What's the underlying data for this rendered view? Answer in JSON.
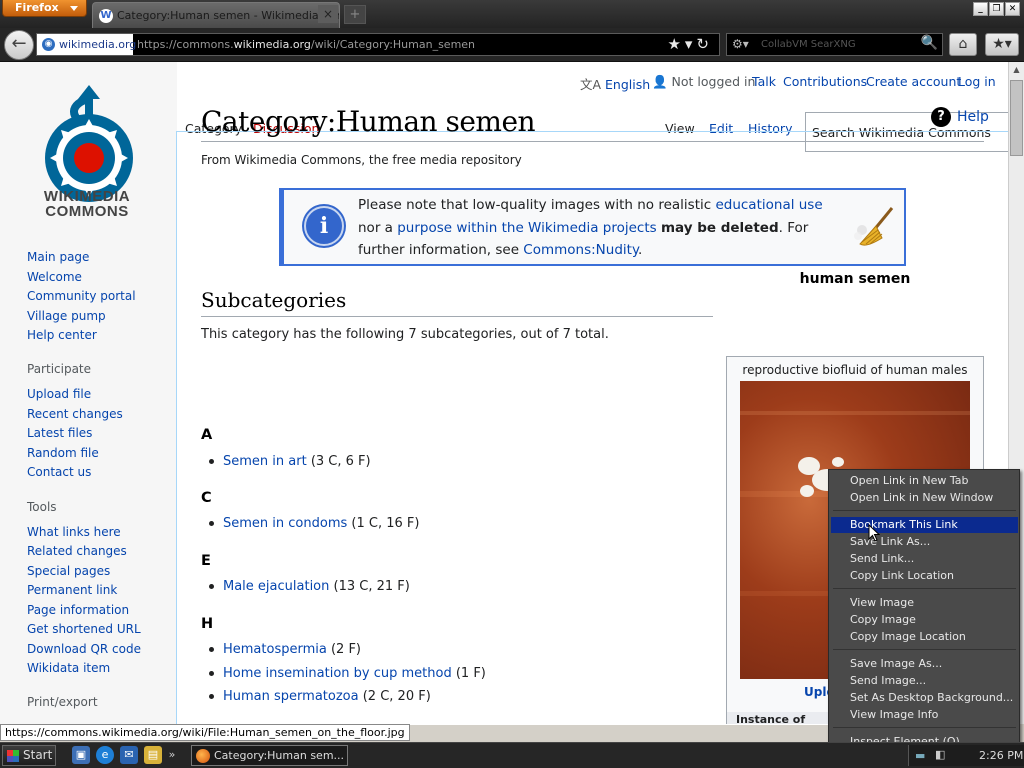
{
  "browser": {
    "menu_button": "Firefox",
    "tab_title": "Category:Human semen - Wikimedia Commons",
    "identity": "wikimedia.org",
    "url_prefix": "https://commons.",
    "url_domain": "wikimedia.org",
    "url_path": "/wiki/Category:Human_semen",
    "search_placeholder": "CollabVM SearXNG"
  },
  "personal": {
    "language": "English",
    "not_logged_in": "Not logged in",
    "talk": "Talk",
    "contributions": "Contributions",
    "create_account": "Create account",
    "login": "Log in"
  },
  "tabs": {
    "category": "Category",
    "discussion": "Discussion",
    "view": "View",
    "edit": "Edit",
    "history": "History",
    "search_placeholder": "Search Wikimedia Commons"
  },
  "logo": {
    "line1": "WIKIMEDIA",
    "line2": "COMMONS"
  },
  "sidebar": {
    "main": [
      "Main page",
      "Welcome",
      "Community portal",
      "Village pump",
      "Help center"
    ],
    "participate_heading": "Participate",
    "participate": [
      "Upload file",
      "Recent changes",
      "Latest files",
      "Random file",
      "Contact us"
    ],
    "tools_heading": "Tools",
    "tools": [
      "What links here",
      "Related changes",
      "Special pages",
      "Permanent link",
      "Page information",
      "Get shortened URL",
      "Download QR code",
      "Wikidata item"
    ],
    "print_heading": "Print/export"
  },
  "page": {
    "title": "Category:Human semen",
    "help": "Help",
    "from": "From Wikimedia Commons, the free media repository"
  },
  "notice": {
    "t1": "Please note that low-quality images with no realistic ",
    "l1": "educational use",
    "t2": " nor a ",
    "l2": "purpose within the Wikimedia projects",
    "t3": " ",
    "b1": "may be deleted",
    "t4": ". For further information, see ",
    "l3": "Commons:Nudity",
    "t5": "."
  },
  "subcategories": {
    "heading": "Subcategories",
    "count_text": "This category has the following 7 subcategories, out of 7 total.",
    "groups": [
      {
        "letter": "A",
        "items": [
          {
            "name": "Semen in art",
            "count": "(3 C, 6 F)"
          }
        ]
      },
      {
        "letter": "C",
        "items": [
          {
            "name": "Semen in condoms",
            "count": "(1 C, 16 F)"
          }
        ]
      },
      {
        "letter": "E",
        "items": [
          {
            "name": "Male ejaculation",
            "count": "(13 C, 21 F)"
          }
        ]
      },
      {
        "letter": "H",
        "items": [
          {
            "name": "Hematospermia",
            "count": "(2 F)"
          },
          {
            "name": "Home insemination by cup method",
            "count": "(1 F)"
          },
          {
            "name": "Human spermatozoa",
            "count": "(2 C, 20 F)"
          }
        ]
      }
    ]
  },
  "infobox": {
    "title": "human semen",
    "description": "reproductive biofluid of human males",
    "upload_partial": "Uplo",
    "instance_partial": "Instance of"
  },
  "status": {
    "link": "https://commons.wikimedia.org/wiki/File:Human_semen_on_the_floor.jpg"
  },
  "context_menu": {
    "group1": [
      "Open Link in New Tab",
      "Open Link in New Window"
    ],
    "group2": [
      "Bookmark This Link",
      "Save Link As...",
      "Send Link...",
      "Copy Link Location"
    ],
    "group3": [
      "View Image",
      "Copy Image",
      "Copy Image Location"
    ],
    "group4": [
      "Save Image As...",
      "Send Image...",
      "Set As Desktop Background...",
      "View Image Info"
    ],
    "group5": [
      "Inspect Element (Q)"
    ],
    "highlighted": "Bookmark This Link"
  },
  "taskbar": {
    "start": "Start",
    "task_title": "Category:Human sem...",
    "clock": "2:26 PM"
  }
}
